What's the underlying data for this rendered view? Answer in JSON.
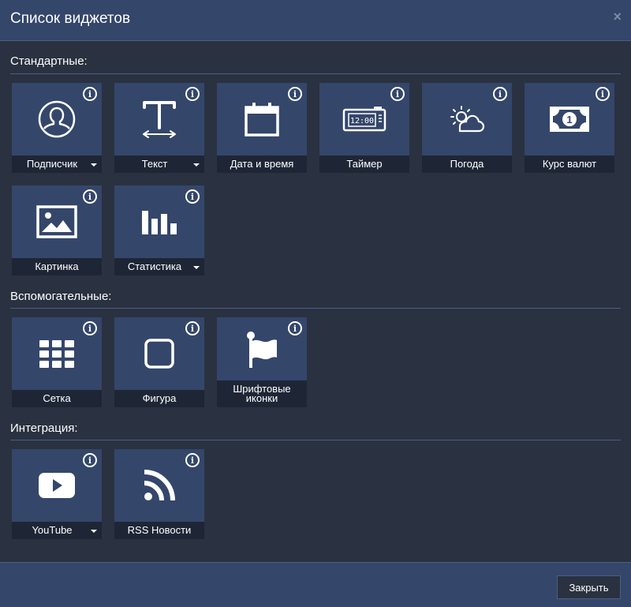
{
  "modal": {
    "title": "Список виджетов",
    "close_glyph": "×",
    "close_label": "Закрыть"
  },
  "sections": [
    {
      "title": "Стандартные:",
      "tiles": [
        {
          "label": "Подписчик",
          "icon": "user-icon",
          "dropdown": true,
          "info": "i"
        },
        {
          "label": "Текст",
          "icon": "text-icon",
          "dropdown": true,
          "info": "i"
        },
        {
          "label": "Дата и время",
          "icon": "calendar-icon",
          "dropdown": false,
          "info": "i"
        },
        {
          "label": "Таймер",
          "icon": "alarm-clock-icon",
          "dropdown": false,
          "info": "i",
          "clock_text": "12:00"
        },
        {
          "label": "Погода",
          "icon": "weather-icon",
          "dropdown": false,
          "info": "i"
        },
        {
          "label": "Курс валют",
          "icon": "banknote-icon",
          "dropdown": false,
          "info": "i",
          "banknote_text": "1"
        },
        {
          "label": "Картинка",
          "icon": "image-icon",
          "dropdown": false,
          "info": "i"
        },
        {
          "label": "Статистика",
          "icon": "bar-chart-icon",
          "dropdown": true,
          "info": "i"
        }
      ]
    },
    {
      "title": "Вспомогательные:",
      "tiles": [
        {
          "label": "Сетка",
          "icon": "grid-icon",
          "dropdown": false,
          "info": "i"
        },
        {
          "label": "Фигура",
          "icon": "square-icon",
          "dropdown": false,
          "info": "i"
        },
        {
          "label": "Шрифтовые иконки",
          "icon": "flag-icon",
          "dropdown": false,
          "info": "i"
        }
      ]
    },
    {
      "title": "Интеграция:",
      "tiles": [
        {
          "label": "YouTube",
          "icon": "youtube-icon",
          "dropdown": true,
          "info": "i"
        },
        {
          "label": "RSS Новости",
          "icon": "rss-icon",
          "dropdown": false,
          "info": "i"
        }
      ]
    }
  ],
  "colors": {
    "background": "#2a3140",
    "tile": "#34466a",
    "label_bar": "#1e2636",
    "divider": "#4a5f86"
  }
}
